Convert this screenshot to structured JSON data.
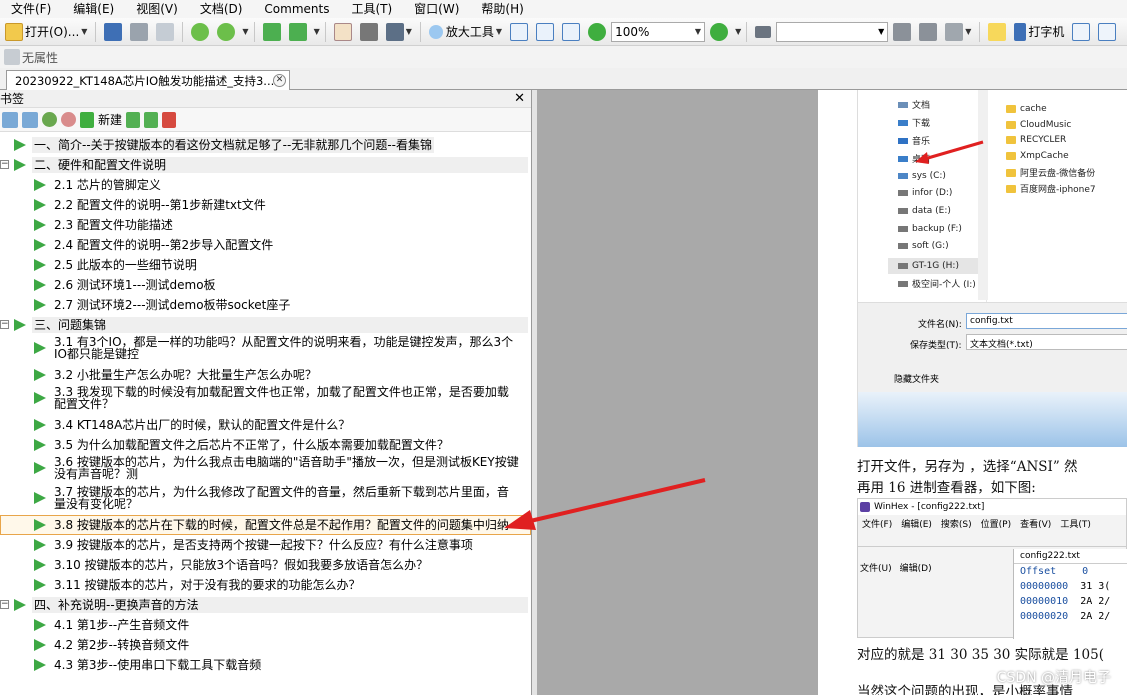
{
  "menu": [
    "文件(F)",
    "编辑(E)",
    "视图(V)",
    "文档(D)",
    "Comments",
    "工具(T)",
    "窗口(W)",
    "帮助(H)"
  ],
  "toolbar": {
    "open_label": "打开(O)...",
    "zoom_tool_label": "放大工具",
    "zoom_value": "100%",
    "typewriter_label": "打字机"
  },
  "toolbar2": {
    "properties_label": "无属性"
  },
  "tab": {
    "title": "20230922_KT148A芯片IO触发功能描述_支持3..."
  },
  "bookmarks": {
    "title": "书签",
    "new_label": "新建",
    "items": [
      {
        "label": "一、简介--关于按键版本的看这份文档就足够了--无非就那几个问题--看集锦"
      },
      {
        "label": "二、硬件和配置文件说明"
      },
      {
        "label": "2.1 芯片的管脚定义"
      },
      {
        "label": "2.2 配置文件的说明--第1步新建txt文件"
      },
      {
        "label": "2.3 配置文件功能描述"
      },
      {
        "label": "2.4 配置文件的说明--第2步导入配置文件"
      },
      {
        "label": "2.5 此版本的一些细节说明"
      },
      {
        "label": "2.6 测试环境1---测试demo板"
      },
      {
        "label": "2.7 测试环境2---测试demo板带socket座子"
      },
      {
        "label": "三、问题集锦"
      },
      {
        "label": "3.1 有3个IO，都是一样的功能吗？从配置文件的说明来看，功能是键控发声，那么3个IO都只能是键控"
      },
      {
        "label": "3.2 小批量生产怎么办呢？大批量生产怎么办呢？"
      },
      {
        "label": "3.3 我发现下载的时候没有加载配置文件也正常，加载了配置文件也正常，是否要加载配置文件？"
      },
      {
        "label": "3.4 KT148A芯片出厂的时候，默认的配置文件是什么？"
      },
      {
        "label": "3.5 为什么加载配置文件之后芯片不正常了，什么版本需要加载配置文件？"
      },
      {
        "label": "3.6 按键版本的芯片，为什么我点击电脑端的\"语音助手\"播放一次，但是测试板KEY按键没有声音呢？测"
      },
      {
        "label": "3.7 按键版本的芯片，为什么我修改了配置文件的音量，然后重新下载到芯片里面，音量没有变化呢？"
      },
      {
        "label": "3.8 按键版本的芯片在下载的时候，配置文件总是不起作用？配置文件的问题集中归纳"
      },
      {
        "label": "3.9 按键版本的芯片，是否支持两个按键一起按下？什么反应？有什么注意事项"
      },
      {
        "label": "3.10 按键版本的芯片，只能放3个语音吗？假如我要多放语音怎么办？"
      },
      {
        "label": "3.11 按键版本的芯片，对于没有我的要求的功能怎么办？"
      },
      {
        "label": "四、补充说明--更换声音的方法"
      },
      {
        "label": "4.1 第1步--产生音频文件"
      },
      {
        "label": "4.2 第2步--转换音频文件"
      },
      {
        "label": "4.3 第3步--使用串口下载工具下载音频"
      }
    ]
  },
  "doc": {
    "explorer_left": [
      "文档",
      "下载",
      "音乐",
      "桌面",
      "sys (C:)",
      "infor (D:)",
      "data (E:)",
      "backup (F:)",
      "soft (G:)",
      "GT-1G (H:)",
      "极空间-个人 (I:)"
    ],
    "explorer_right": [
      "cache",
      "CloudMusic",
      "RECYCLER",
      "XmpCache",
      "阿里云盘-微信备份",
      "百度网盘-iphone7"
    ],
    "filename_label": "文件名(N):",
    "filename_value": "config.txt",
    "filetype_label": "保存类型(T):",
    "filetype_value": "文本文档(*.txt)",
    "hide_folders": "隐藏文件夹",
    "para1": "打开文件，另存为 ，选择“ANSI” 然",
    "para2": "再用 16 进制查看器，如下图:",
    "winhex_title": "WinHex - [config222.txt]",
    "winhex_menu": [
      "文件(F)",
      "编辑(E)",
      "搜索(S)",
      "位置(P)",
      "查看(V)",
      "工具(T)"
    ],
    "winhex_left_menu": [
      "文件(U)",
      "编辑(D)"
    ],
    "winhex_tab": "config222.txt",
    "winhex_offset": "Offset",
    "winhex_col0": "0",
    "winhex_rows": [
      {
        "off": "00000000",
        "v": "31 3("
      },
      {
        "off": "00000010",
        "v": "2A 2/"
      },
      {
        "off": "00000020",
        "v": "2A 2/"
      }
    ],
    "para3": "对应的就是 31 30 35 30   实际就是 105(",
    "para4": "当然这个问题的出现，是小概率事情",
    "watermark": "CSDN @清月电子"
  }
}
